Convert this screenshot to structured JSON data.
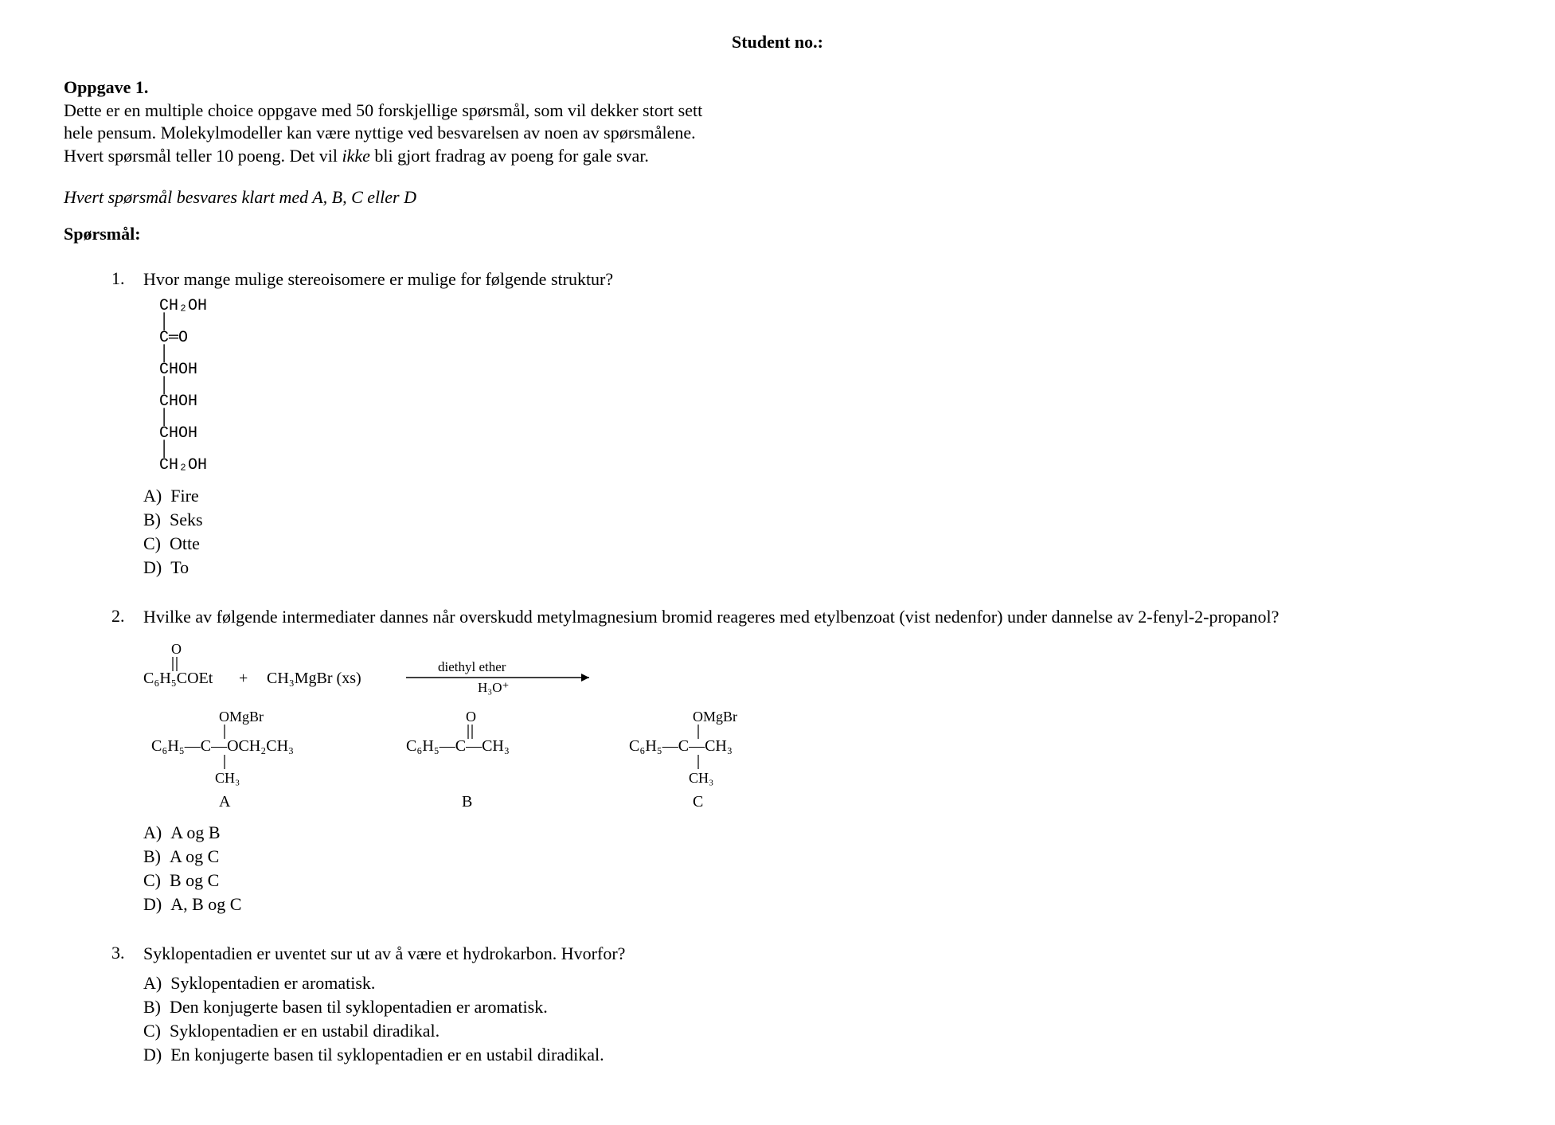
{
  "header": {
    "student_no_label": "Student no.:"
  },
  "task": {
    "title": "Oppgave 1.",
    "intro_line1": "Dette er en multiple choice oppgave med 50 forskjellige spørsmål, som vil dekker stort sett",
    "intro_line2": "hele pensum. Molekylmodeller kan være nyttige ved besvarelsen av noen av spørsmålene.",
    "intro_line3_plain_a": "Hvert spørsmål teller 10 poeng. Det vil ",
    "intro_line3_italic": "ikke",
    "intro_line3_plain_b": " bli gjort fradrag av poeng for gale svar."
  },
  "instruction": "Hvert spørsmål besvares klart med A, B, C eller D",
  "section_title": "Spørsmål:",
  "q1": {
    "num": "1.",
    "text": "Hvor mange mulige stereoisomere er mulige for følgende struktur?",
    "structure": {
      "l1": "CH₂OH",
      "l2": "│",
      "l3": "C═O",
      "l4": "│",
      "l5": "CHOH",
      "l6": "│",
      "l7": "CHOH",
      "l8": "│",
      "l9": "CHOH",
      "l10": "│",
      "l11": "CH₂OH"
    },
    "options": {
      "a_label": "A)",
      "a_text": "Fire",
      "b_label": "B)",
      "b_text": "Seks",
      "c_label": "C)",
      "c_text": "Otte",
      "d_label": "D)",
      "d_text": "To"
    }
  },
  "q2": {
    "num": "2.",
    "text": "Hvilke av følgende intermediater dannes når overskudd metylmagnesium bromid reageres med etylbenzoat (vist nedenfor) under dannelse av 2-fenyl-2-propanol?",
    "reaction": {
      "left": "C₆H₅COEt",
      "plus": "+",
      "reagent": "CH₃MgBr (xs)",
      "cond_top": "diethyl ether",
      "cond_bot": "H₃O⁺"
    },
    "intermediates": {
      "a": {
        "top": "OMgBr",
        "row": "C₆H₅—C—OCH₂CH₃",
        "bot": "CH₃",
        "label": "A"
      },
      "b": {
        "o": "O",
        "row": "C₆H₅—C—CH₃",
        "label": "B"
      },
      "c": {
        "top": "OMgBr",
        "row": "C₆H₅—C—CH₃",
        "bot": "CH₃",
        "label": "C"
      }
    },
    "options": {
      "a_label": "A)",
      "a_text": "A og B",
      "b_label": "B)",
      "b_text": "A og C",
      "c_label": "C)",
      "c_text": "B og C",
      "d_label": "D)",
      "d_text": "A, B og C"
    }
  },
  "q3": {
    "num": "3.",
    "text": "Syklopentadien er uventet sur ut av å være et hydrokarbon. Hvorfor?",
    "options": {
      "a_label": "A)",
      "a_text": "Syklopentadien er aromatisk.",
      "b_label": "B)",
      "b_text": "Den konjugerte basen til syklopentadien er aromatisk.",
      "c_label": "C)",
      "c_text": "Syklopentadien er en ustabil diradikal.",
      "d_label": "D)",
      "d_text": "En konjugerte basen til syklopentadien er en ustabil diradikal."
    }
  }
}
